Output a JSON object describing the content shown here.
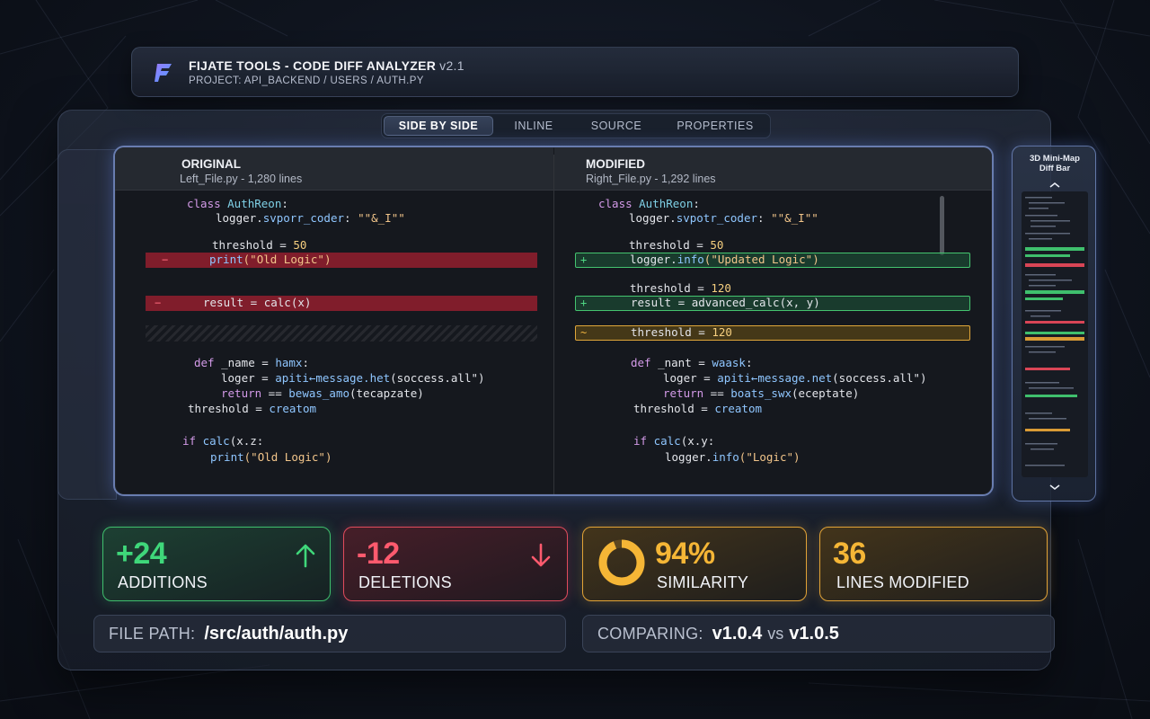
{
  "app": {
    "title": "FIJATE TOOLS - CODE DIFF ANALYZER",
    "version": "v2.1",
    "project_path": "PROJECT: API_BACKEND / USERS / AUTH.PY"
  },
  "tabs": [
    {
      "label": "SIDE BY SIDE",
      "active": true
    },
    {
      "label": "INLINE",
      "active": false
    },
    {
      "label": "SOURCE",
      "active": false
    },
    {
      "label": "PROPERTIES",
      "active": false
    }
  ],
  "rail": {
    "icons": [
      "window-icon",
      "list-icon",
      "gear-icon"
    ]
  },
  "left_pane": {
    "title": "ORIGINAL",
    "subtitle": "Left_File.py - 1,280 lines",
    "lines": {
      "l1_kw": "class ",
      "l1_cls": "AuthReon",
      "l1_rest": ":",
      "l2_a": "logger.",
      "l2_fn": "svporr_coder",
      "l2_b": ": ",
      "l2_str": "\"\"&_I\"\"",
      "l3_a": "threshold = ",
      "l3_num": "50",
      "l4_fn": "print",
      "l4_str": "(\"Old Logic\")",
      "l5": "result = calc(x)",
      "l6_kw": "def ",
      "l6_a": "_name",
      "l6_b": " = ",
      "l6_fn": "hamx",
      "l6_c": ":",
      "l7_a": "loger = ",
      "l7_fn": "apiti←message.het",
      "l7_b": "(soccess.all\")",
      "l8_kw": "return",
      "l8_a": " == ",
      "l8_fn": "bewas_amo",
      "l8_b": "(tecapzate)",
      "l9_a": "threshold = ",
      "l9_fn": "creatom",
      "l10_kw": "if ",
      "l10_fn": "calc",
      "l10_a": "(x.z:",
      "l11_fn": "print",
      "l11_str": "(\"Old Logic\")"
    },
    "markers": [
      "−",
      "−"
    ]
  },
  "right_pane": {
    "title": "MODIFIED",
    "subtitle": "Right_File.py - 1,292 lines",
    "lines": {
      "r1_kw": "class ",
      "r1_cls": "AuthReon",
      "r1_rest": ":",
      "r2_a": "logger.",
      "r2_fn": "svpotr_coder",
      "r2_b": ": ",
      "r2_str": "\"\"&_I\"\"",
      "r3_a": "threshold = ",
      "r3_num": "50",
      "r4_a": "logger.",
      "r4_fn": "info",
      "r4_str": "(\"Updated Logic\")",
      "r5_a": "threshold = ",
      "r5_num": "120",
      "r6": "result = advanced_calc(x, y)",
      "r7_a": "threshold = ",
      "r7_num": "120",
      "r8_kw": "def ",
      "r8_a": "_nant",
      "r8_b": " = ",
      "r8_fn": "waask",
      "r8_c": ":",
      "r9_a": "loger = ",
      "r9_fn": "apiti←message.net",
      "r9_b": "(soccess.all\")",
      "r10_kw": "return",
      "r10_a": " == ",
      "r10_fn": "boats_swx",
      "r10_b": "(eceptate)",
      "r11_a": "threshold = ",
      "r11_fn": "creatom",
      "r12_kw": "if ",
      "r12_fn": "calc",
      "r12_a": "(x.y:",
      "r13_a": "logger.",
      "r13_fn": "info",
      "r13_str": "(\"Logic\")"
    },
    "markers": [
      "+",
      "+",
      "~"
    ]
  },
  "minimap": {
    "title_line1": "3D Mini-Map",
    "title_line2": "Diff Bar"
  },
  "stats": [
    {
      "value": "+24",
      "label": "ADDITIONS",
      "color": "#3fd77a",
      "icon": "arrow-up-icon"
    },
    {
      "value": "-12",
      "label": "DELETIONS",
      "color": "#ff5a6e",
      "icon": "arrow-down-icon"
    },
    {
      "value": "94%",
      "label": "SIMILARITY",
      "color": "#f5b636",
      "icon": "similarity-ring-icon",
      "ring_fraction": 0.94
    },
    {
      "value": "36",
      "label": "LINES MODIFIED",
      "color": "#f5b636"
    }
  ],
  "footer": {
    "file_path_label": "FILE PATH:",
    "file_path_value": "/src/auth/auth.py",
    "comparing_label": "COMPARING:",
    "version_a": "v1.0.4",
    "vs": "vs",
    "version_b": "v1.0.5"
  },
  "colors": {
    "added": "#3fd77a",
    "deleted": "#ff5a6e",
    "modified": "#f5b636",
    "accent": "#8fb0ff"
  }
}
